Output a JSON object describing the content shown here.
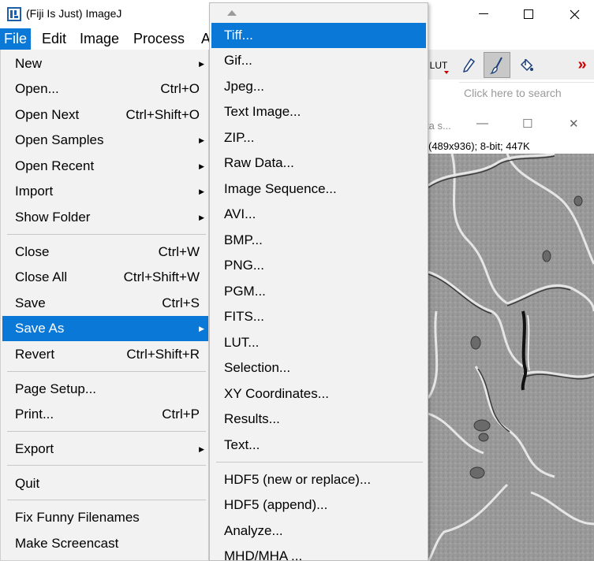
{
  "window": {
    "title": "(Fiji Is Just) ImageJ",
    "minimize": "—",
    "maximize": "☐",
    "close": "✕"
  },
  "menubar": {
    "items": [
      "File",
      "Edit",
      "Image",
      "Process",
      "A"
    ]
  },
  "toolbar": {
    "lut_label": "LUT",
    "more_label": "»",
    "search_placeholder": "Click here to search"
  },
  "image_window": {
    "title_fragment": "ta s...",
    "info": "(489x936); 8-bit; 447K",
    "minimize": "—",
    "maximize": "☐",
    "close": "✕"
  },
  "file_menu": {
    "items": [
      {
        "label": "New",
        "shortcut": "",
        "submenu": true
      },
      {
        "label": "Open...",
        "shortcut": "Ctrl+O",
        "submenu": false
      },
      {
        "label": "Open Next",
        "shortcut": "Ctrl+Shift+O",
        "submenu": false
      },
      {
        "label": "Open Samples",
        "shortcut": "",
        "submenu": true
      },
      {
        "label": "Open Recent",
        "shortcut": "",
        "submenu": true
      },
      {
        "label": "Import",
        "shortcut": "",
        "submenu": true
      },
      {
        "label": "Show Folder",
        "shortcut": "",
        "submenu": true
      },
      {
        "label": "Close",
        "shortcut": "Ctrl+W",
        "submenu": false
      },
      {
        "label": "Close All",
        "shortcut": "Ctrl+Shift+W",
        "submenu": false
      },
      {
        "label": "Save",
        "shortcut": "Ctrl+S",
        "submenu": false
      },
      {
        "label": "Save As",
        "shortcut": "",
        "submenu": true,
        "active": true
      },
      {
        "label": "Revert",
        "shortcut": "Ctrl+Shift+R",
        "submenu": false
      },
      {
        "label": "Page Setup...",
        "shortcut": "",
        "submenu": false
      },
      {
        "label": "Print...",
        "shortcut": "Ctrl+P",
        "submenu": false
      },
      {
        "label": "Export",
        "shortcut": "",
        "submenu": true
      },
      {
        "label": "Quit",
        "shortcut": "",
        "submenu": false
      },
      {
        "label": "Fix Funny Filenames",
        "shortcut": "",
        "submenu": false
      },
      {
        "label": "Make Screencast",
        "shortcut": "",
        "submenu": false
      }
    ]
  },
  "save_as_menu": {
    "items": [
      {
        "label": "Tiff...",
        "active": true
      },
      {
        "label": "Gif..."
      },
      {
        "label": "Jpeg..."
      },
      {
        "label": "Text Image..."
      },
      {
        "label": "ZIP..."
      },
      {
        "label": "Raw Data..."
      },
      {
        "label": "Image Sequence..."
      },
      {
        "label": "AVI..."
      },
      {
        "label": "BMP..."
      },
      {
        "label": "PNG..."
      },
      {
        "label": "PGM..."
      },
      {
        "label": "FITS..."
      },
      {
        "label": "LUT..."
      },
      {
        "label": "Selection..."
      },
      {
        "label": "XY Coordinates..."
      },
      {
        "label": "Results..."
      },
      {
        "label": "Text..."
      },
      {
        "label": "HDF5 (new or replace)..."
      },
      {
        "label": "HDF5 (append)..."
      },
      {
        "label": "Analyze..."
      },
      {
        "label": "MHD/MHA ..."
      }
    ]
  },
  "colors": {
    "highlight": "#0a78d7",
    "menu_bg": "#f2f2f2",
    "toolbar_red": "#cc0000"
  }
}
